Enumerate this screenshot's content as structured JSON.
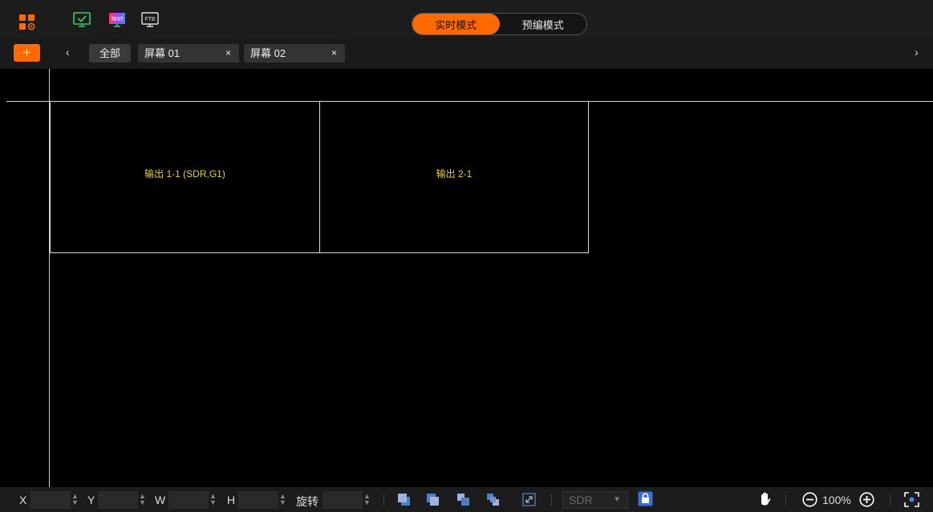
{
  "toolbar": {
    "icons": [
      "apps-icon",
      "monitor-check-icon",
      "test-monitor-icon",
      "ftb-monitor-icon"
    ],
    "test_badge": "TEST",
    "ftb_badge": "FTB",
    "accent": "#ff6a00"
  },
  "modes": {
    "live": "实时模式",
    "preview": "预编模式",
    "active": "live"
  },
  "tabs": {
    "add_label": "+",
    "prev_arrow": "‹",
    "next_arrow": "›",
    "all_label": "全部",
    "screens": [
      {
        "label": "屏幕 01",
        "close": "×"
      },
      {
        "label": "屏幕 02",
        "close": "×"
      }
    ]
  },
  "canvas": {
    "outputs": [
      {
        "label": "输出 1-1 (SDR,G1)"
      },
      {
        "label": "输出 2-1"
      }
    ],
    "label_color": "#e8d800"
  },
  "bottom": {
    "x_label": "X",
    "y_label": "Y",
    "w_label": "W",
    "h_label": "H",
    "rotate_label": "旋转",
    "x_value": "",
    "y_value": "",
    "w_value": "",
    "h_value": "",
    "rotate_value": "",
    "sdr_value": "SDR",
    "zoom": "100%"
  }
}
